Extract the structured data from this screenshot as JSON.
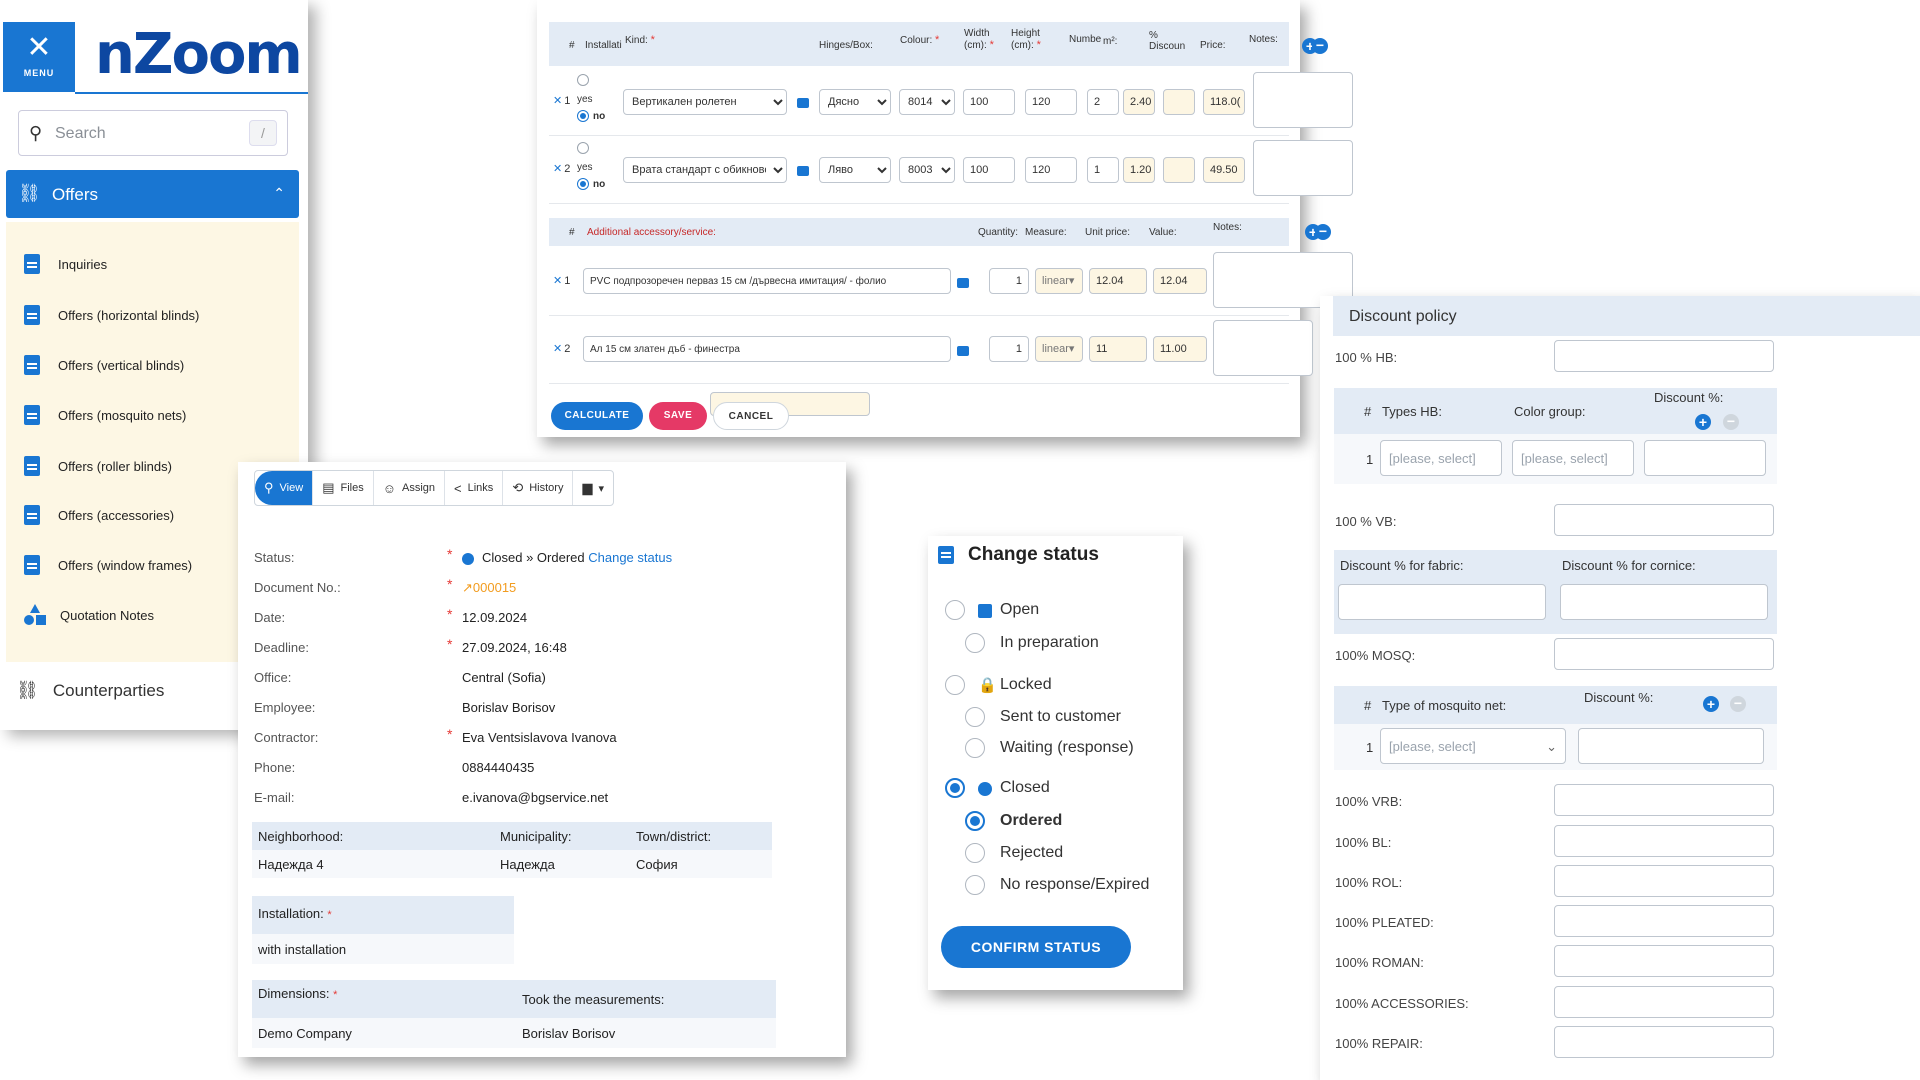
{
  "sidebar": {
    "menu_label": "MENU",
    "logo": "nZoom",
    "search_placeholder": "Search",
    "search_shortcut": "/",
    "offers_label": "Offers",
    "items": [
      {
        "label": "Inquiries"
      },
      {
        "label": "Offers (horizontal blinds)"
      },
      {
        "label": "Offers (vertical blinds)"
      },
      {
        "label": "Offers (mosquito nets)"
      },
      {
        "label": "Offers (roller blinds)"
      },
      {
        "label": "Offers (accessories)"
      },
      {
        "label": "Offers (window frames)"
      },
      {
        "label": "Quotation Notes"
      }
    ],
    "counterparties_label": "Counterparties"
  },
  "top_form": {
    "headers": {
      "num": "#",
      "installation": "Installati",
      "kind": "Kind:",
      "hinges": "Hinges/Box:",
      "colour": "Colour:",
      "width": "Width (cm):",
      "height": "Height (cm):",
      "number": "Numbe",
      "m2": "m²:",
      "discount": "% Discoun",
      "price": "Price:",
      "notes": "Notes:"
    },
    "rows": [
      {
        "num": "1",
        "yes": "yes",
        "no": "no",
        "kind": "Вертикален ролетен",
        "hinges": "Дясно",
        "colour": "8014",
        "width": "100",
        "height": "120",
        "number": "2",
        "m2": "2.40",
        "price": "118.0("
      },
      {
        "num": "2",
        "yes": "yes",
        "no": "no",
        "kind": "Врата стандарт с обикновени",
        "hinges": "Ляво",
        "colour": "8003",
        "width": "100",
        "height": "120",
        "number": "1",
        "m2": "1.20",
        "price": "49.50"
      }
    ],
    "acc_headers": {
      "num": "#",
      "label": "Additional accessory/service:",
      "quantity": "Quantity:",
      "measure": "Measure:",
      "unit_price": "Unit price:",
      "value": "Value:",
      "notes": "Notes:"
    },
    "acc_rows": [
      {
        "num": "1",
        "name": "PVC подпрозоречен перваз 15 см /дървесна имитация/ - фолио",
        "quantity": "1",
        "measure": "linear",
        "unit_price": "12.04",
        "value": "12.04"
      },
      {
        "num": "2",
        "name": "Ал 15 см златен дъб - финестра",
        "quantity": "1",
        "measure": "linear",
        "unit_price": "11",
        "value": "11.00"
      }
    ],
    "buttons": {
      "calculate": "CALCULATE",
      "save": "SAVE",
      "cancel": "CANCEL"
    }
  },
  "detail": {
    "toolbar": [
      {
        "label": "View"
      },
      {
        "label": "Files"
      },
      {
        "label": "Assign"
      },
      {
        "label": "Links"
      },
      {
        "label": "History"
      }
    ],
    "fields": {
      "status_label": "Status:",
      "status_value": "Closed » Ordered",
      "change_status": "Change status",
      "docno_label": "Document No.:",
      "docno_value": "000015",
      "date_label": "Date:",
      "date_value": "12.09.2024",
      "deadline_label": "Deadline:",
      "deadline_value": "27.09.2024, 16:48",
      "office_label": "Office:",
      "office_value": "Central (Sofia)",
      "employee_label": "Employee:",
      "employee_value": "Borislav Borisov",
      "contractor_label": "Contractor:",
      "contractor_value": "Eva Ventsislavova Ivanova",
      "phone_label": "Phone:",
      "phone_value": "0884440435",
      "email_label": "E-mail:",
      "email_value": "e.ivanova@bgservice.net"
    },
    "location": {
      "neighborhood_label": "Neighborhood:",
      "municipality_label": "Municipality:",
      "town_label": "Town/district:",
      "neighborhood": "Надежда 4",
      "municipality": "Надежда",
      "town": "София"
    },
    "installation_label": "Installation:",
    "installation_value": "with installation",
    "dimensions_label": "Dimensions:",
    "measurements_label": "Took the measurements:",
    "dimensions_value": "Demo Company",
    "measurements_value": "Borislav Borisov"
  },
  "status": {
    "title": "Change status",
    "open": "Open",
    "in_preparation": "In preparation",
    "locked": "Locked",
    "sent": "Sent to customer",
    "waiting": "Waiting (response)",
    "closed": "Closed",
    "ordered": "Ordered",
    "rejected": "Rejected",
    "no_response": "No response/Expired",
    "confirm": "CONFIRM STATUS"
  },
  "discount": {
    "title": "Discount policy",
    "hb": "100 % HB:",
    "num": "#",
    "types_hb": "Types HB:",
    "color_group": "Color group:",
    "discount_pct": "Discount %:",
    "row_num": "1",
    "please_select": "[please, select]",
    "vb": "100 % VB:",
    "fabric": "Discount % for fabric:",
    "cornice": "Discount % for cornice:",
    "mosq": "100% MOSQ:",
    "type_mosq": "Type of mosquito net:",
    "rows": [
      {
        "label": "100% VRB:"
      },
      {
        "label": "100% BL:"
      },
      {
        "label": "100% ROL:"
      },
      {
        "label": "100% PLEATED:"
      },
      {
        "label": "100% ROMAN:"
      },
      {
        "label": "100% ACCESSORIES:"
      },
      {
        "label": "100% REPAIR:"
      }
    ]
  }
}
